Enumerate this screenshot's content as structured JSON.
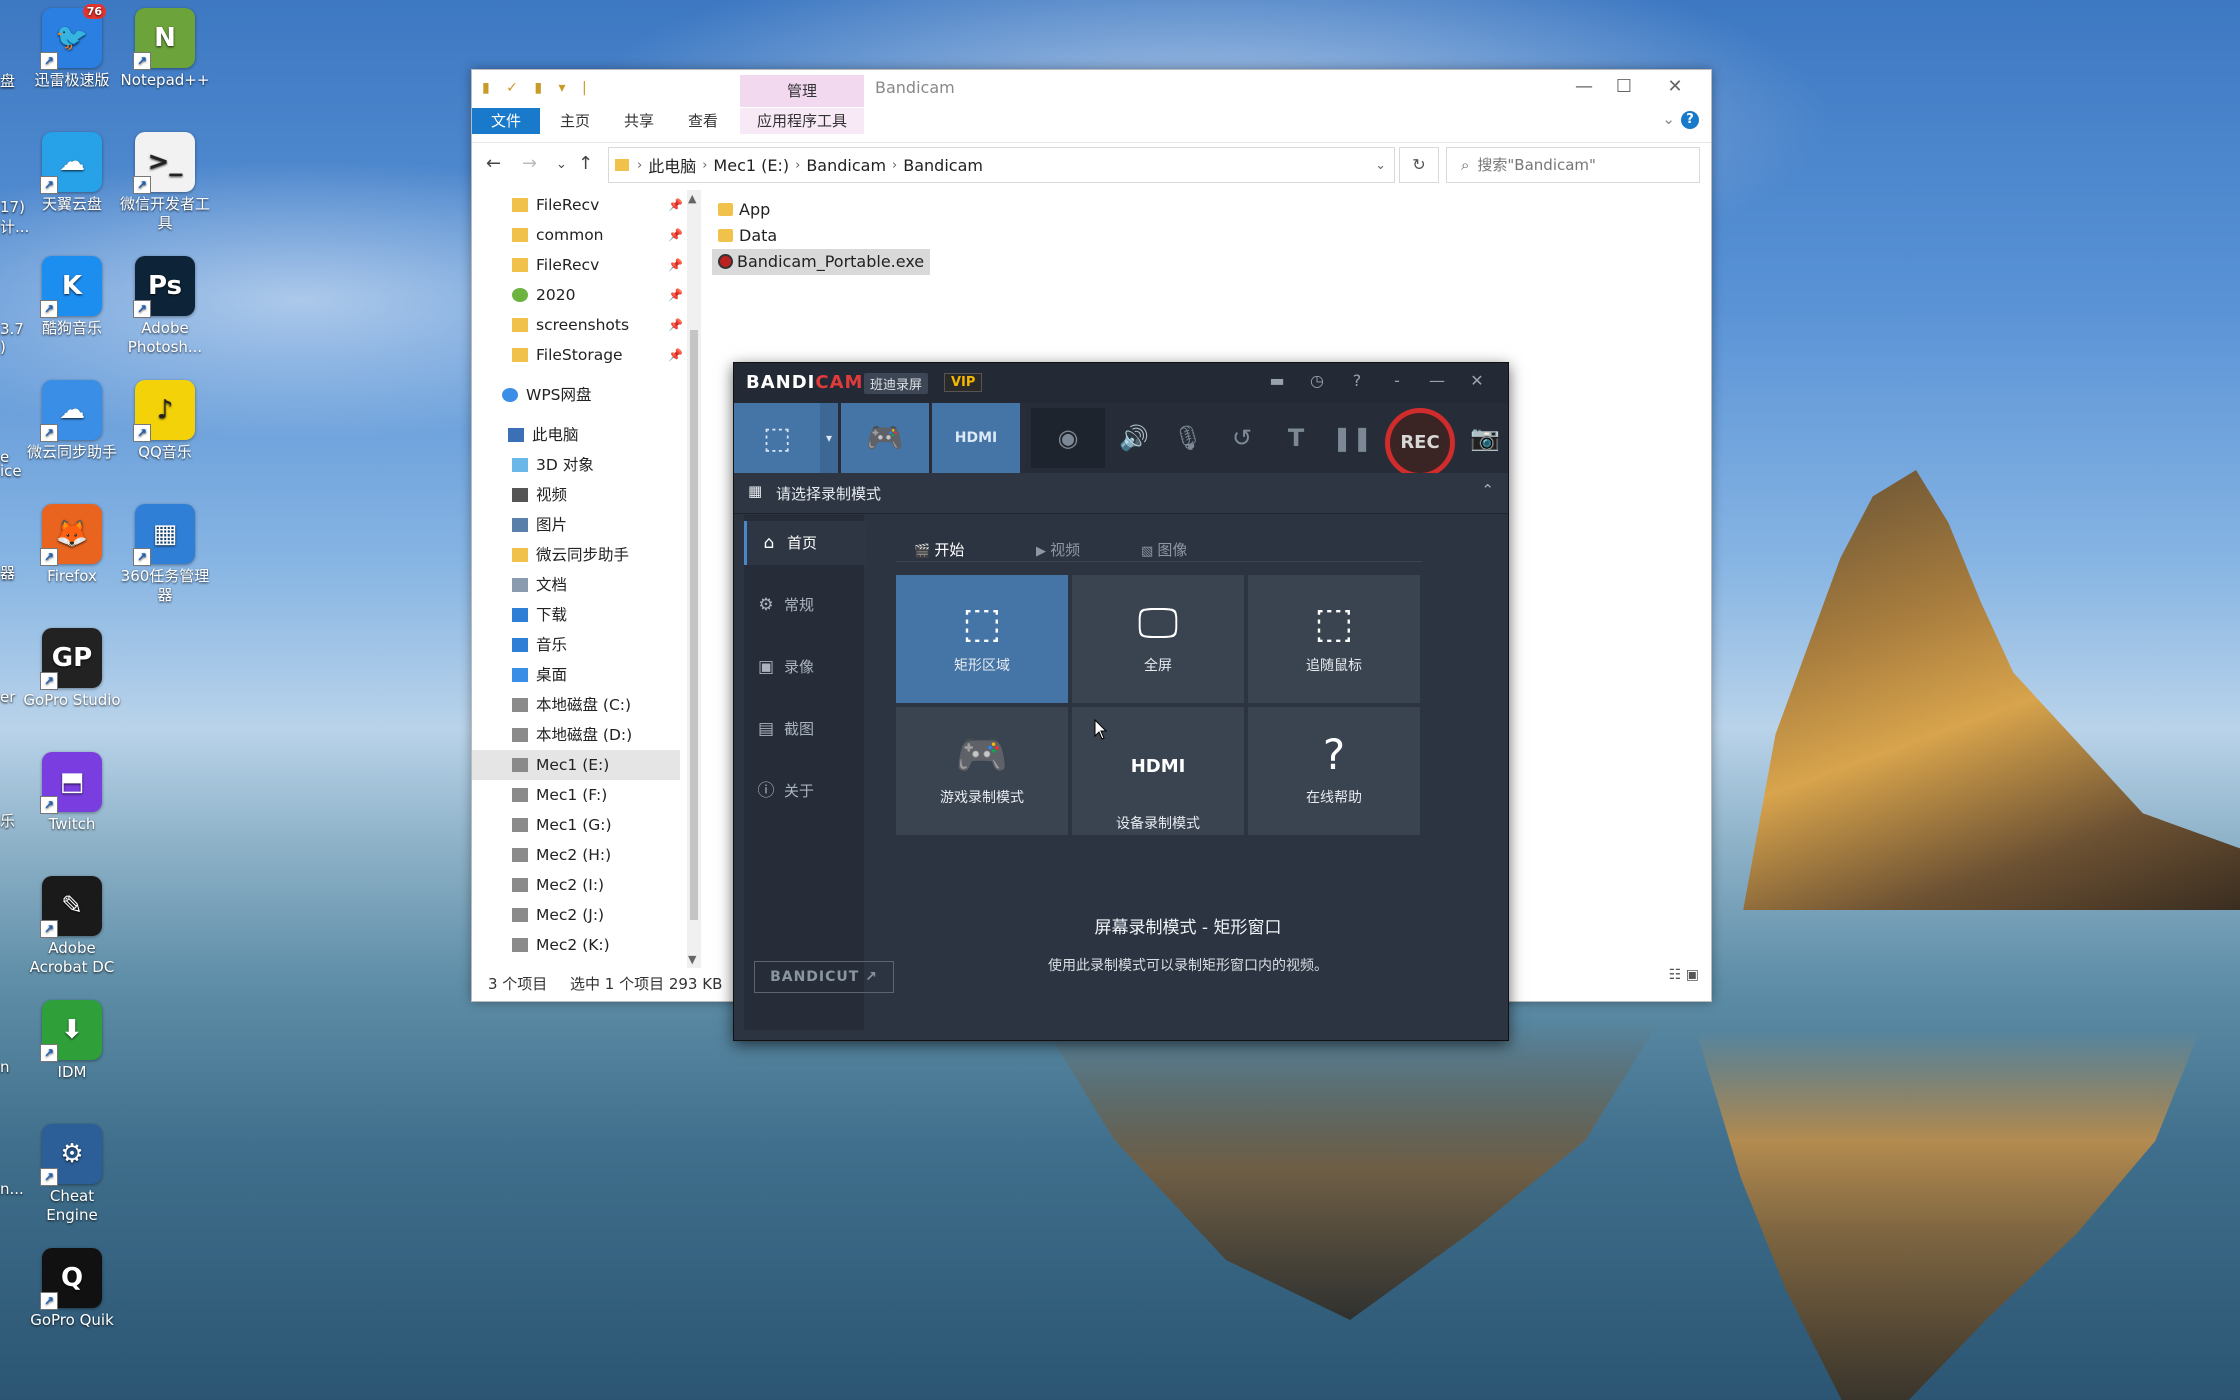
{
  "desktop": {
    "icons": [
      {
        "label": "迅雷极速版",
        "badge": "76",
        "color": "#2a7fe0",
        "glyph": "🐦"
      },
      {
        "label": "Notepad++",
        "color": "#6ca33a",
        "glyph": "N"
      },
      {
        "label": "天翼云盘",
        "color": "#27a1e8",
        "glyph": "☁"
      },
      {
        "label": "微信开发者工具",
        "color": "#f2f2f2",
        "glyph": ">_"
      },
      {
        "label": "酷狗音乐",
        "color": "#1c8ef0",
        "glyph": "K"
      },
      {
        "label": "Adobe Photosh...",
        "color": "#0d2438",
        "glyph": "Ps"
      },
      {
        "label": "微云同步助手",
        "color": "#3a8ee6",
        "glyph": "☁"
      },
      {
        "label": "QQ音乐",
        "color": "#f4d20a",
        "glyph": "♪"
      },
      {
        "label": "Firefox",
        "color": "#e8641f",
        "glyph": "🦊"
      },
      {
        "label": "360任务管理器",
        "color": "#2f7fd6",
        "glyph": "▦"
      },
      {
        "label": "GoPro Studio",
        "color": "#222",
        "glyph": "GP"
      },
      {
        "label": "Twitch",
        "color": "#7a3ee0",
        "glyph": "⬒"
      },
      {
        "label": "Adobe Acrobat DC",
        "color": "#1a1a1a",
        "glyph": "✎"
      },
      {
        "label": "IDM",
        "color": "#2f9f3a",
        "glyph": "⬇"
      },
      {
        "label": "Cheat Engine",
        "color": "#2c5f98",
        "glyph": "⚙"
      },
      {
        "label": "GoPro Quik",
        "color": "#111",
        "glyph": "Q"
      }
    ],
    "left_cut": [
      "盘",
      "17)",
      "计...",
      "3.7",
      ")",
      "e",
      "ice",
      "器",
      "er",
      "乐",
      "n",
      "n..."
    ]
  },
  "explorer": {
    "quick_access": "▮ ✓ ▮ ▾ |",
    "manage_tab": "管理",
    "window_title": "Bandicam",
    "ribbon_tabs": [
      "文件",
      "主页",
      "共享",
      "查看"
    ],
    "app_tools": "应用程序工具",
    "breadcrumb": [
      "此电脑",
      "Mec1 (E:)",
      "Bandicam",
      "Bandicam"
    ],
    "search_placeholder": "搜索\"Bandicam\"",
    "nav_items": [
      {
        "label": "FileRecv",
        "pinned": true,
        "icon": "folder"
      },
      {
        "label": "common",
        "pinned": true,
        "icon": "folder"
      },
      {
        "label": "FileRecv",
        "pinned": true,
        "icon": "folder"
      },
      {
        "label": "2020",
        "pinned": true,
        "icon": "green-check"
      },
      {
        "label": "screenshots",
        "pinned": true,
        "icon": "folder"
      },
      {
        "label": "FileStorage",
        "pinned": true,
        "icon": "folder"
      },
      {
        "label": "WPS网盘",
        "icon": "cloud"
      },
      {
        "label": "此电脑",
        "icon": "pc"
      },
      {
        "label": "3D 对象",
        "icon": "cube"
      },
      {
        "label": "视频",
        "icon": "video"
      },
      {
        "label": "图片",
        "icon": "picture"
      },
      {
        "label": "微云同步助手",
        "icon": "folder"
      },
      {
        "label": "文档",
        "icon": "doc"
      },
      {
        "label": "下载",
        "icon": "download"
      },
      {
        "label": "音乐",
        "icon": "music"
      },
      {
        "label": "桌面",
        "icon": "desktop"
      },
      {
        "label": "本地磁盘 (C:)",
        "icon": "drive"
      },
      {
        "label": "本地磁盘 (D:)",
        "icon": "drive"
      },
      {
        "label": "Mec1 (E:)",
        "icon": "drive",
        "selected": true
      },
      {
        "label": "Mec1 (F:)",
        "icon": "drive"
      },
      {
        "label": "Mec1 (G:)",
        "icon": "drive"
      },
      {
        "label": "Mec2 (H:)",
        "icon": "drive"
      },
      {
        "label": "Mec2 (I:)",
        "icon": "drive"
      },
      {
        "label": "Mec2 (J:)",
        "icon": "drive"
      },
      {
        "label": "Mec2 (K:)",
        "icon": "drive"
      }
    ],
    "files": [
      {
        "name": "App",
        "type": "folder"
      },
      {
        "name": "Data",
        "type": "folder"
      },
      {
        "name": "Bandicam_Portable.exe",
        "type": "exe",
        "selected": true
      }
    ],
    "status": {
      "count": "3 个项目",
      "selection": "选中 1 个项目  293 KB"
    }
  },
  "bandicam": {
    "logo_band": "BANDI",
    "logo_cam": "CAM",
    "subtitle": "班迪录屏",
    "vip": "VIP",
    "rec_label": "REC",
    "header_title": "请选择录制模式",
    "sidebar": [
      {
        "label": "首页",
        "icon": "home",
        "active": true
      },
      {
        "label": "常规",
        "icon": "gear"
      },
      {
        "label": "录像",
        "icon": "video"
      },
      {
        "label": "截图",
        "icon": "image"
      },
      {
        "label": "关于",
        "icon": "info"
      }
    ],
    "bandicut_label": "BANDICUT ↗",
    "subtabs": [
      {
        "label": "开始",
        "active": true
      },
      {
        "label": "视频"
      },
      {
        "label": "图像"
      }
    ],
    "tiles": [
      {
        "label": "矩形区域",
        "active": true
      },
      {
        "label": "全屏"
      },
      {
        "label": "追随鼠标"
      },
      {
        "label": "游戏录制模式"
      },
      {
        "label": "设备录制模式"
      },
      {
        "label": "在线帮助"
      }
    ],
    "mode_title": "屏幕录制模式 - 矩形窗口",
    "mode_desc": "使用此录制模式可以录制矩形窗口内的视频。",
    "accent": "#4574a6",
    "rec_color": "#d02c2c"
  }
}
